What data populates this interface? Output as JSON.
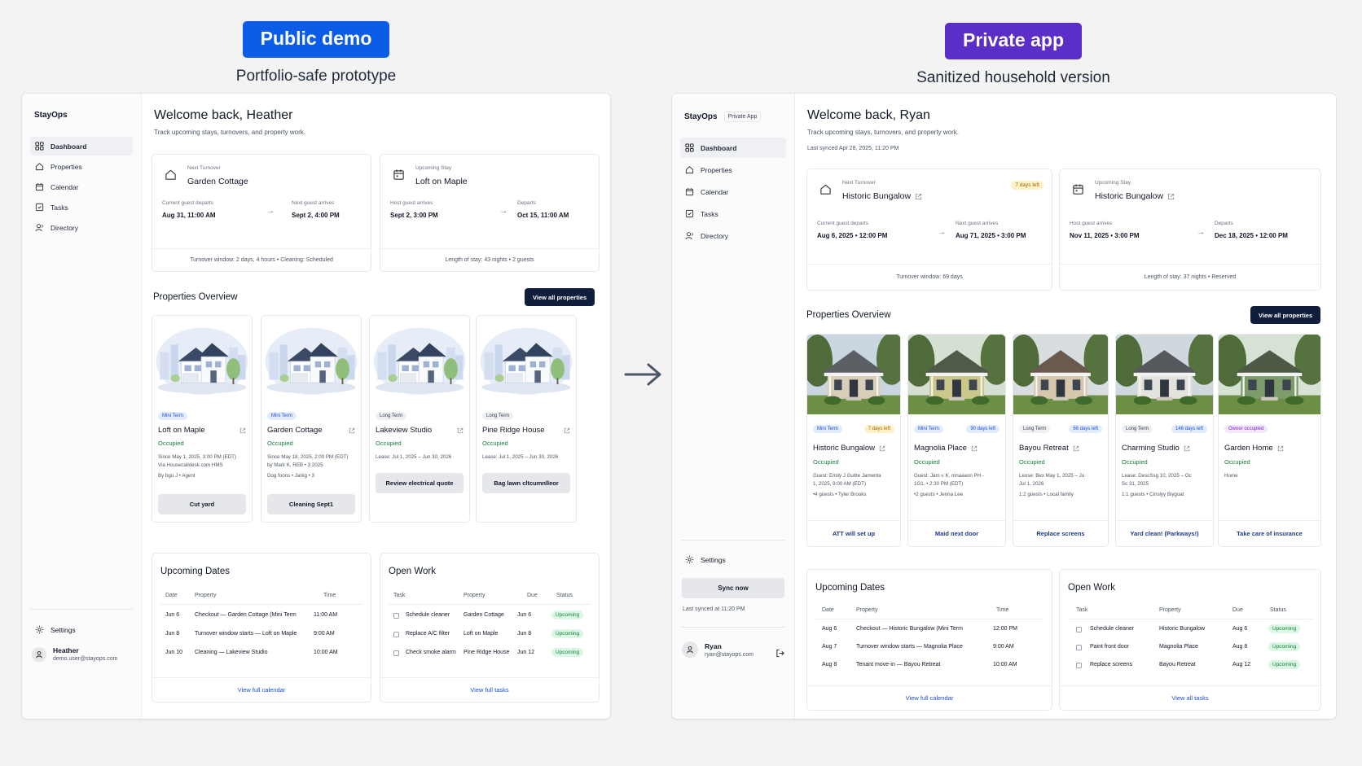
{
  "left_panel": {
    "pill": "Public demo",
    "subtitle": "Portfolio-safe prototype",
    "brand": "StayOps",
    "nav": [
      "Dashboard",
      "Properties",
      "Calendar",
      "Tasks",
      "Directory"
    ],
    "settings": "Settings",
    "user": {
      "name": "Heather",
      "email": "demo.user@stayops.com"
    },
    "welcome": "Welcome back, Heather",
    "track": "Track upcoming stays, turnovers, and property work.",
    "turnover": {
      "kicker": "Next Turnover",
      "title": "Garden Cottage",
      "left_label": "Current guest departs",
      "left_value": "Aug 31, 11:00 AM",
      "right_label": "Next guest arrives",
      "right_value": "Sept 2, 4:00 PM",
      "footer": "Turnover window: 2 days, 4 hours • Cleaning: Scheduled"
    },
    "stay": {
      "kicker": "Upcoming Stay",
      "title": "Loft on Maple",
      "left_label": "Host guest arrives",
      "left_value": "Sept 2, 3:00 PM",
      "right_label": "Departs",
      "right_value": "Oct 15, 11:00 AM",
      "footer": "Length of stay: 43 nights • 2 guests"
    },
    "overview_title": "Properties Overview",
    "view_all": "View all properties",
    "properties": [
      {
        "tag": "Mini Term",
        "name": "Loft on Maple",
        "status": "Occupied",
        "lines": [
          "Since May 1, 2025, 3:00 PM (EDT)",
          "Via Housecalldesk.com HMS",
          "By bgu J • Agent"
        ],
        "button": "Cut yard"
      },
      {
        "tag": "Mini Term",
        "name": "Garden Cottage",
        "status": "Occupied",
        "lines": [
          "Since May 18, 2025, 2:00 PM (EDT)",
          "by Mark K, REB • 3 2025",
          "Dog foons • Jarkg • 3"
        ],
        "button": "Cleaning Sept1"
      },
      {
        "tag": "Long Term",
        "name": "Lakeview Studio",
        "status": "Occupied",
        "lines": [
          "Lease: Jul 1, 2025 – Jun 30, 2026"
        ],
        "button": "Review electrical quote"
      },
      {
        "tag": "Long Term",
        "name": "Pine Ridge House",
        "status": "Occupied",
        "lines": [
          "Lease: Jul 1, 2025 – Jun 30, 2026"
        ],
        "button": "Bag lawn cltcumnlleor"
      }
    ],
    "dates": {
      "title": "Upcoming Dates",
      "headers": [
        "Date",
        "Property",
        "Time"
      ],
      "rows": [
        [
          "Jun 6",
          "Checkout — Garden Cottage (Mini Term",
          "11:00 AM"
        ],
        [
          "Jun 8",
          "Turnover window starts — Loft on Maple",
          "9:00 AM"
        ],
        [
          "Jun 10",
          "Cleaning — Lakeview Studio",
          "10:00 AM"
        ]
      ],
      "link": "View full calendar"
    },
    "work": {
      "title": "Open Work",
      "headers": [
        "Task",
        "Property",
        "Due",
        "Status"
      ],
      "rows": [
        [
          "Schedule cleaner",
          "Garden Cottage",
          "Jun 6",
          "Upcoming"
        ],
        [
          "Replace A/C filter",
          "Loft on Maple",
          "Jun 8",
          "Upcoming"
        ],
        [
          "Check smoke alarm",
          "Pine Ridge House",
          "Jun 12",
          "Upcoming"
        ]
      ],
      "link": "View full tasks"
    }
  },
  "right_panel": {
    "pill": "Private app",
    "subtitle": "Sanitized household version",
    "brand": "StayOps",
    "brand_tag": "Private App",
    "nav": [
      "Dashboard",
      "Properties",
      "Calendar",
      "Tasks",
      "Directory"
    ],
    "settings": "Settings",
    "sync_button": "Sync now",
    "sync_note": "Last synced at 11:20 PM",
    "user": {
      "name": "Ryan",
      "email": "ryan@stayops.com"
    },
    "welcome": "Welcome back, Ryan",
    "track": "Track upcoming stays, turnovers, and property work.",
    "synced": "Last synced Apr 28, 2025, 11:20 PM",
    "turnover": {
      "kicker": "Next Turnover",
      "title": "Historic Bungalow",
      "badge": "7 days left",
      "left_label": "Current guest departs",
      "left_value": "Aug 6, 2025 • 12:00 PM",
      "right_label": "Next guest arrives",
      "right_value": "Aug 71, 2025 • 3:00 PM",
      "footer": "Turnover window: 69 days"
    },
    "stay": {
      "kicker": "Upcoming Stay",
      "title": "Historic Bungalow",
      "left_label": "Host guest arrives",
      "left_value": "Nov 11, 2025 • 3:00 PM",
      "right_label": "Departs",
      "right_value": "Dec 18, 2025 • 12:00 PM",
      "footer": "Length of stay: 37 nights • Reserved"
    },
    "overview_title": "Properties Overview",
    "view_all": "View all properties",
    "properties": [
      {
        "tag": "Mini Term",
        "tag_kind": "mini",
        "badge": "7 days left",
        "badge_kind": "warn",
        "name": "Historic Bungalow",
        "status": "Occupied",
        "lines": [
          "Guest: Emily J.Guitte Jamenta",
          "1, 2025, 9:00 AM (EDT)",
          "•4 guests • Tyler Brooks"
        ],
        "footer": "ATT will set up"
      },
      {
        "tag": "Mini Term",
        "tag_kind": "mini",
        "badge": "90 days left",
        "badge_kind": "info",
        "name": "Magnolia Place",
        "status": "Occupied",
        "lines": [
          "Guest: Jam ≤ K. mnaaaon PH -",
          "1G1, • 2:30 PM (EDT)",
          "•2 guests • Jenna Lee"
        ],
        "footer": "Maid next door"
      },
      {
        "tag": "Long Term",
        "tag_kind": "long",
        "badge": "66 days left",
        "badge_kind": "info",
        "name": "Bayou Retreat",
        "status": "Occupied",
        "lines": [
          "Leose: Bex May 1, 2025 – Ju",
          "Jul 1, 2026",
          "1:2 guests • Local family"
        ],
        "footer": "Replace screens"
      },
      {
        "tag": "Long Term",
        "tag_kind": "long",
        "badge": "146 days left",
        "badge_kind": "info",
        "name": "Charming Studio",
        "status": "Occupied",
        "lines": [
          "Lease: DescSsg 10, 2025 – Oc",
          "Sc 31, 2025",
          "1:1 guests • Cinslyy Biygoat"
        ],
        "footer": "Yard clean! (Parkways!)"
      },
      {
        "tag": "Owner occupied",
        "tag_kind": "owner",
        "badge": "",
        "badge_kind": "",
        "name": "Garden Home",
        "status": "Occupied",
        "lines": [
          "Home"
        ],
        "footer": "Take care of insurance"
      }
    ],
    "dates": {
      "title": "Upcoming Dates",
      "headers": [
        "Date",
        "Property",
        "Time"
      ],
      "rows": [
        [
          "Aug 6",
          "Checkout — Historic Bungalow (Mini Term",
          "12:00 PM"
        ],
        [
          "Aug 7",
          "Turnover window starts — Magnolia Place",
          "9:00 AM"
        ],
        [
          "Aug 8",
          "Tenant move-in — Bayou Retreat",
          "10:00 AM"
        ]
      ],
      "link": "View full calendar"
    },
    "work": {
      "title": "Open Work",
      "headers": [
        "Task",
        "Property",
        "Due",
        "Status"
      ],
      "rows": [
        [
          "Schedule cleaner",
          "Historic Bungalow",
          "Aug 6",
          "Upcoming"
        ],
        [
          "Paint front door",
          "Magnolia Place",
          "Aug 8",
          "Upcoming"
        ],
        [
          "Replace screens",
          "Bayou Retreat",
          "Aug 12",
          "Upcoming"
        ]
      ],
      "link": "View all tasks"
    }
  },
  "colors": {
    "public_pill": "#0b5ce6",
    "private_pill": "#5b2fc7",
    "dark_button": "#0f1e3a",
    "occupied": "#15803d",
    "link": "#1d4ed8"
  },
  "icons": [
    "grid-icon",
    "home-icon",
    "calendar-icon",
    "checklist-icon",
    "person-icon",
    "gear-icon",
    "user-icon",
    "logout-icon",
    "external-link-icon",
    "arrow-right-icon"
  ]
}
